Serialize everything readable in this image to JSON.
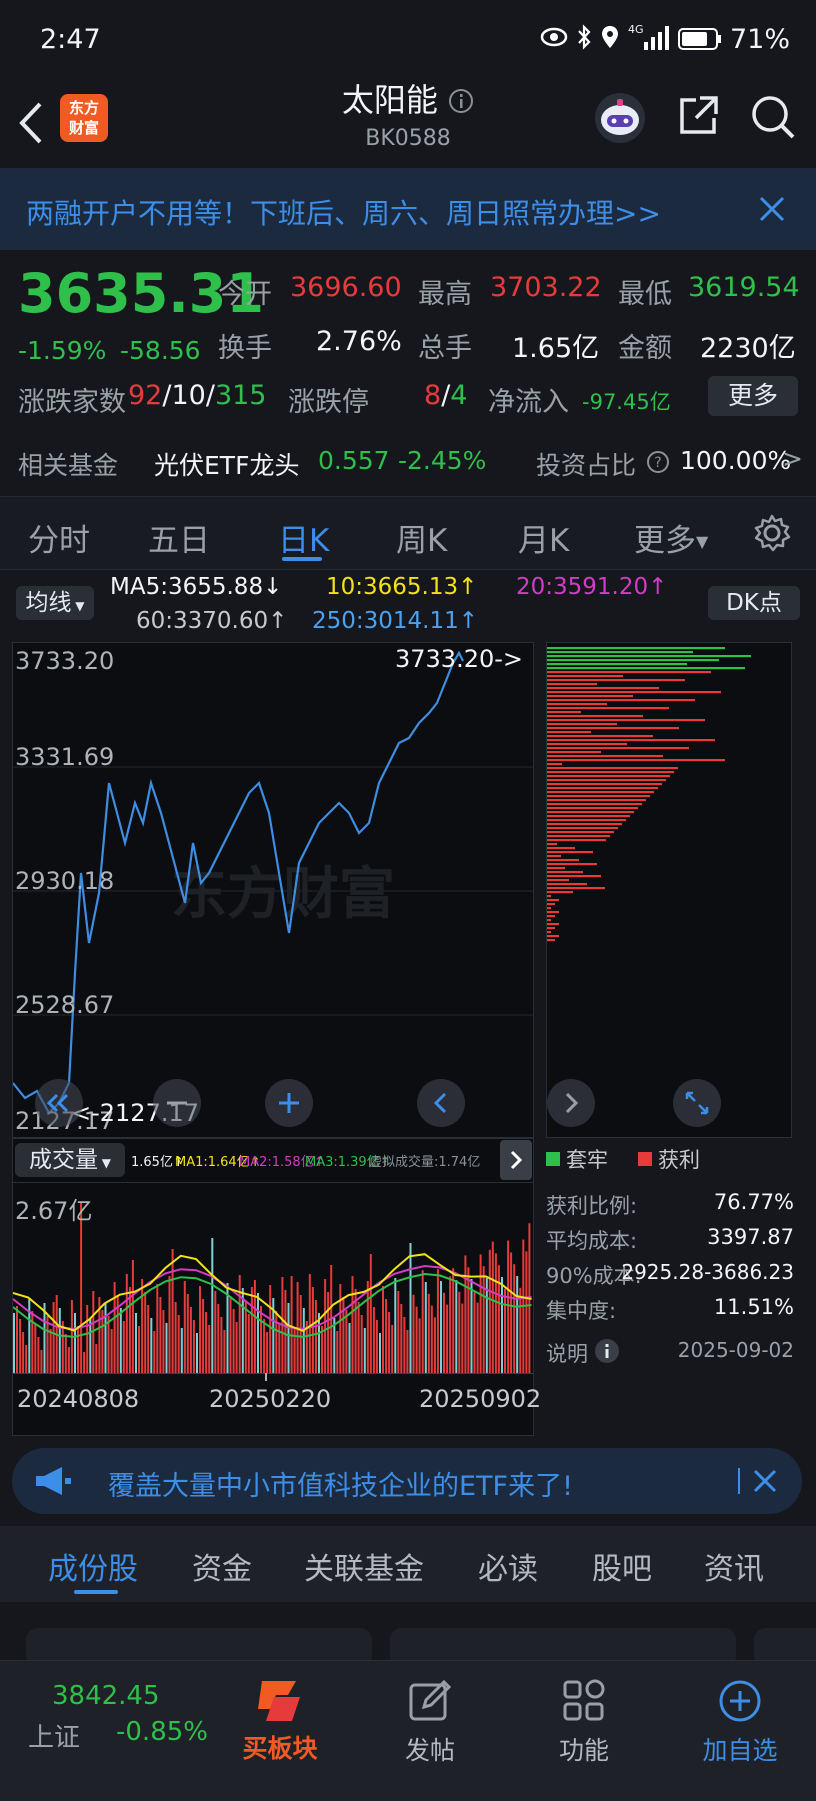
{
  "status_bar": {
    "time": "2:47",
    "battery": "71%",
    "network": "4G"
  },
  "header": {
    "title": "太阳能",
    "code": "BK0588",
    "logo_text_1": "东方",
    "logo_text_2": "财富"
  },
  "promo": {
    "text": "两融开户不用等！下班后、周六、周日照常办理>>"
  },
  "quote": {
    "price": "3635.31",
    "change_pct": "-1.59%",
    "change": "-58.56",
    "open_label": "今开",
    "open": "3696.60",
    "high_label": "最高",
    "high": "3703.22",
    "low_label": "最低",
    "low": "3619.54",
    "turnover_label": "换手",
    "turnover": "2.76%",
    "volume_label": "总手",
    "volume": "1.65亿",
    "amount_label": "金额",
    "amount": "2230亿",
    "breadth_label": "涨跌家数",
    "up": "92",
    "flat": "10",
    "down": "315",
    "limit_label": "涨跌停",
    "limit_up": "8",
    "limit_down": "4",
    "inflow_label": "净流入",
    "inflow": "-97.45亿",
    "more_button": "更多",
    "fund_label": "相关基金",
    "fund_name": "光伏ETF龙头",
    "fund_price": "0.557",
    "fund_change": "-2.45%",
    "invest_label": "投资占比",
    "invest_value": "100.00%"
  },
  "ktabs": [
    "分时",
    "五日",
    "日K",
    "周K",
    "月K",
    "更多"
  ],
  "ma": {
    "selector": "均线",
    "ma5": "MA5:3655.88↓",
    "ma10": "10:3665.13↑",
    "ma20": "20:3591.20↑",
    "ma60": "60:3370.60↑",
    "ma250": "250:3014.11↑",
    "dk_button": "DK点"
  },
  "kchart": {
    "y_labels": [
      "3733.20",
      "3331.69",
      "2930.18",
      "2528.67",
      "2127.17"
    ],
    "high_marker": "3733.20->",
    "low_marker": "<-2127.17",
    "watermark": "东方财富"
  },
  "chip": {
    "legend_trap": "套牢",
    "legend_profit": "获利",
    "rows": [
      {
        "label": "获利比例:",
        "value": "76.77%"
      },
      {
        "label": "平均成本:",
        "value": "3397.87"
      },
      {
        "label": "90%成本:",
        "value": "2925.28-3686.23"
      },
      {
        "label": "集中度:",
        "value": "11.51%"
      }
    ],
    "note_label": "说明",
    "date": "2025-09-02"
  },
  "volume": {
    "selector": "成交量",
    "vol": "1.65亿↑",
    "ma1": "MA1:1.64亿↑",
    "ma2": "MA2:1.58亿↑",
    "ma3": "MA3:1.39亿↑",
    "virtual": "虚拟成交量:1.74亿",
    "top_label": "2.67亿",
    "dates": [
      "20240808",
      "20250220",
      "20250902"
    ]
  },
  "ad": {
    "text": "覆盖大量中小市值科技企业的ETF来了!"
  },
  "section_tabs": [
    "成份股",
    "资金",
    "关联基金",
    "必读",
    "股吧",
    "资讯"
  ],
  "bottom_nav": {
    "index_value": "3842.45",
    "index_name": "上证",
    "index_change": "-0.85%",
    "buy": "买板块",
    "post": "发帖",
    "func": "功能",
    "add": "加自选"
  },
  "colors": {
    "up": "#e63b3b",
    "down": "#2fbf4b",
    "accent": "#3d8ee8",
    "kline": "#3f8de0"
  }
}
